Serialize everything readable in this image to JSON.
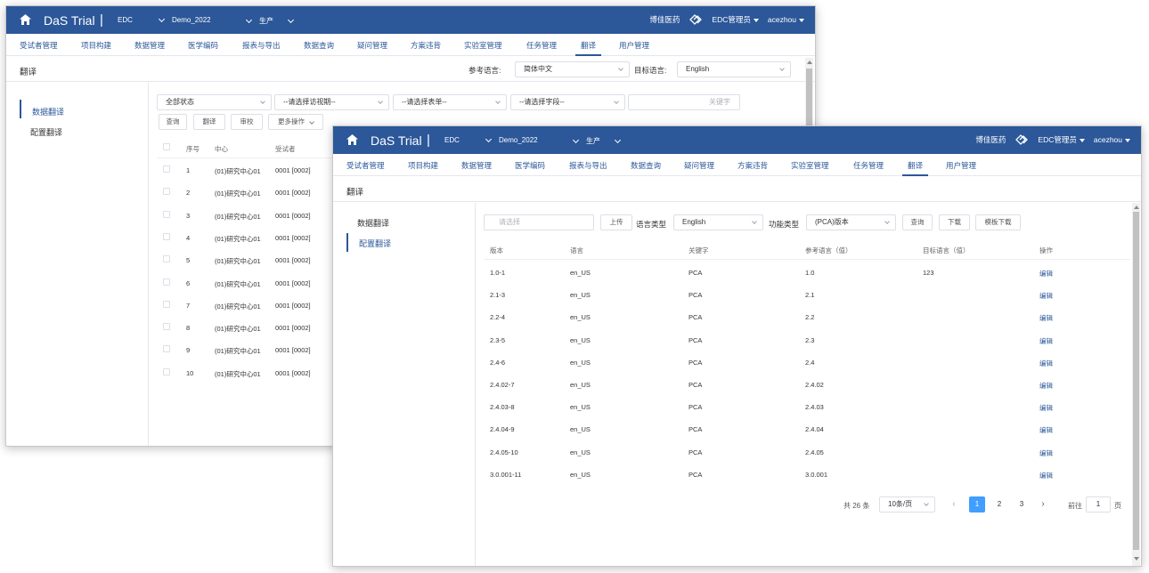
{
  "app": {
    "brand": "DaS Trial",
    "separator": "|",
    "module": "EDC",
    "project": "Demo_2022",
    "env": "生产",
    "company": "博佳医药",
    "role": "EDC管理员",
    "user": "acezhou"
  },
  "nav": [
    "受试者管理",
    "项目构建",
    "数据管理",
    "医学编码",
    "报表与导出",
    "数据查询",
    "疑问管理",
    "方案违背",
    "实验室管理",
    "任务管理",
    "翻译",
    "用户管理"
  ],
  "nav_active": "翻译",
  "page_title": "翻译",
  "side_menu": [
    "数据翻译",
    "配置翻译"
  ],
  "back": {
    "ref_lang_label": "参考语言:",
    "ref_lang_value": "简体中文",
    "target_lang_label": "目标语言:",
    "target_lang_value": "English",
    "filters": {
      "status": "全部状态",
      "visit": "--请选择访视期--",
      "form": "--请选择表单--",
      "field": "--请选择字段--",
      "keyword_placeholder": "关键字"
    },
    "buttons": {
      "query": "查询",
      "translate": "翻译",
      "review": "审校",
      "more": "更多操作"
    },
    "table": {
      "headers": [
        "序号",
        "中心",
        "受试者"
      ],
      "rows": [
        [
          "1",
          "(01)研究中心01",
          "0001 [0002]"
        ],
        [
          "2",
          "(01)研究中心01",
          "0001 [0002]"
        ],
        [
          "3",
          "(01)研究中心01",
          "0001 [0002]"
        ],
        [
          "4",
          "(01)研究中心01",
          "0001 [0002]"
        ],
        [
          "5",
          "(01)研究中心01",
          "0001 [0002]"
        ],
        [
          "6",
          "(01)研究中心01",
          "0001 [0002]"
        ],
        [
          "7",
          "(01)研究中心01",
          "0001 [0002]"
        ],
        [
          "8",
          "(01)研究中心01",
          "0001 [0002]"
        ],
        [
          "9",
          "(01)研究中心01",
          "0001 [0002]"
        ],
        [
          "10",
          "(01)研究中心01",
          "0001 [0002]"
        ]
      ]
    }
  },
  "front": {
    "toolbar": {
      "file_placeholder": "请选择",
      "upload": "上传",
      "lang_type_label": "语言类型",
      "lang_type_value": "English",
      "func_type_label": "功能类型",
      "func_type_value": "(PCA)版本",
      "query": "查询",
      "download": "下载",
      "template_download": "模板下载"
    },
    "table": {
      "headers": [
        "版本",
        "语言",
        "关键字",
        "参考语言（值）",
        "目标语言（值）",
        "操作"
      ],
      "rows": [
        [
          "1.0-1",
          "en_US",
          "PCA",
          "1.0",
          "123",
          "编辑"
        ],
        [
          "2.1-3",
          "en_US",
          "PCA",
          "2.1",
          "",
          "编辑"
        ],
        [
          "2.2-4",
          "en_US",
          "PCA",
          "2.2",
          "",
          "编辑"
        ],
        [
          "2.3-5",
          "en_US",
          "PCA",
          "2.3",
          "",
          "编辑"
        ],
        [
          "2.4-6",
          "en_US",
          "PCA",
          "2.4",
          "",
          "编辑"
        ],
        [
          "2.4.02-7",
          "en_US",
          "PCA",
          "2.4.02",
          "",
          "编辑"
        ],
        [
          "2.4.03-8",
          "en_US",
          "PCA",
          "2.4.03",
          "",
          "编辑"
        ],
        [
          "2.4.04-9",
          "en_US",
          "PCA",
          "2.4.04",
          "",
          "编辑"
        ],
        [
          "2.4.05-10",
          "en_US",
          "PCA",
          "2.4.05",
          "",
          "编辑"
        ],
        [
          "3.0.001-11",
          "en_US",
          "PCA",
          "3.0.001",
          "",
          "编辑"
        ]
      ]
    },
    "pagination": {
      "total": "共 26 条",
      "page_size": "10条/页",
      "pages": [
        "1",
        "2",
        "3"
      ],
      "current": "1",
      "goto_prefix": "前往",
      "goto_value": "1",
      "goto_suffix": "页"
    }
  },
  "colors": {
    "header_bg": "#2c5799",
    "accent": "#2c5799",
    "page_active": "#409eff"
  }
}
